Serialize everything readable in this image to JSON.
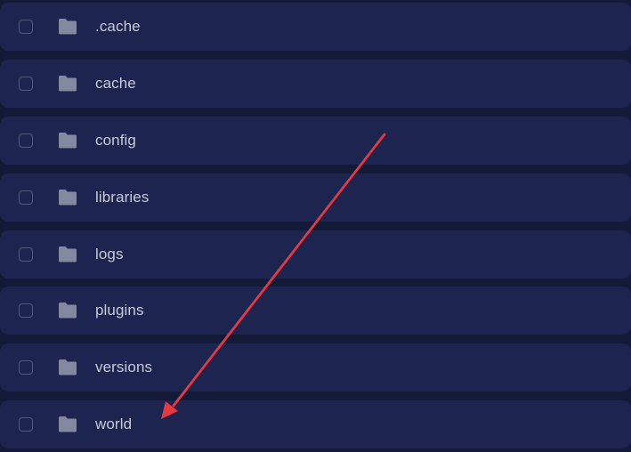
{
  "file_list": {
    "items": [
      {
        "name": ".cache",
        "type": "folder",
        "icon": "folder-icon",
        "checked": false
      },
      {
        "name": "cache",
        "type": "folder",
        "icon": "folder-icon",
        "checked": false
      },
      {
        "name": "config",
        "type": "folder",
        "icon": "folder-icon",
        "checked": false
      },
      {
        "name": "libraries",
        "type": "folder",
        "icon": "folder-icon",
        "checked": false
      },
      {
        "name": "logs",
        "type": "folder",
        "icon": "folder-icon",
        "checked": false
      },
      {
        "name": "plugins",
        "type": "folder",
        "icon": "folder-icon",
        "checked": false
      },
      {
        "name": "versions",
        "type": "folder",
        "icon": "folder-icon",
        "checked": false
      },
      {
        "name": "world",
        "type": "folder",
        "icon": "folder-icon",
        "checked": false
      }
    ]
  },
  "colors": {
    "background": "#131a38",
    "row": "#1d2450",
    "text": "#c7cbd8",
    "folder_icon": "#848a9e",
    "checkbox_border": "#535b7c",
    "annotation_arrow": "#e5383f"
  },
  "annotation": {
    "type": "arrow",
    "points_to": "world"
  }
}
